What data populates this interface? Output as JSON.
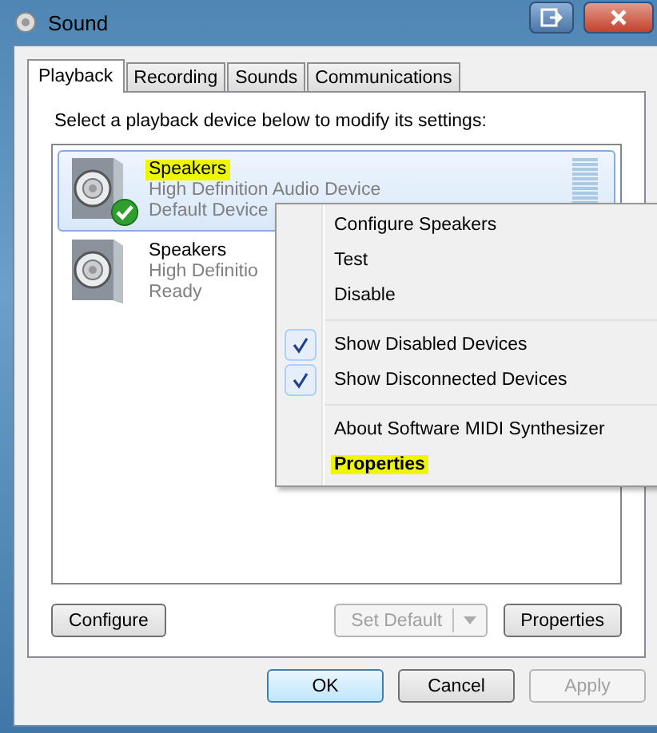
{
  "window": {
    "title": "Sound"
  },
  "tabs": [
    {
      "label": "Playback",
      "selected": true
    },
    {
      "label": "Recording",
      "selected": false
    },
    {
      "label": "Sounds",
      "selected": false
    },
    {
      "label": "Communications",
      "selected": false
    }
  ],
  "instruction": "Select a playback device below to modify its settings:",
  "devices": [
    {
      "name": "Speakers",
      "description": "High Definition Audio Device",
      "status": "Default Device",
      "selected": true,
      "is_default": true,
      "name_highlighted": true
    },
    {
      "name": "Speakers",
      "description": "High Definitio",
      "status": "Ready",
      "selected": false,
      "is_default": false,
      "name_highlighted": false
    }
  ],
  "context_menu": [
    {
      "kind": "item",
      "label": "Configure Speakers",
      "checked": false,
      "highlighted": false,
      "bold": false
    },
    {
      "kind": "item",
      "label": "Test",
      "checked": false,
      "highlighted": false,
      "bold": false
    },
    {
      "kind": "item",
      "label": "Disable",
      "checked": false,
      "highlighted": false,
      "bold": false
    },
    {
      "kind": "separator"
    },
    {
      "kind": "item",
      "label": "Show Disabled Devices",
      "checked": true,
      "highlighted": false,
      "bold": false
    },
    {
      "kind": "item",
      "label": "Show Disconnected Devices",
      "checked": true,
      "highlighted": false,
      "bold": false
    },
    {
      "kind": "separator"
    },
    {
      "kind": "item",
      "label": "About Software MIDI Synthesizer",
      "checked": false,
      "highlighted": false,
      "bold": false
    },
    {
      "kind": "item",
      "label": "Properties",
      "checked": false,
      "highlighted": true,
      "bold": true
    }
  ],
  "panel_buttons": {
    "configure": {
      "label": "Configure",
      "disabled": false
    },
    "set_default": {
      "label": "Set Default",
      "disabled": true
    },
    "properties": {
      "label": "Properties",
      "disabled": false
    }
  },
  "dialog_buttons": [
    {
      "label": "OK",
      "disabled": false,
      "default": true
    },
    {
      "label": "Cancel",
      "disabled": false,
      "default": false
    },
    {
      "label": "Apply",
      "disabled": true,
      "default": false
    }
  ]
}
